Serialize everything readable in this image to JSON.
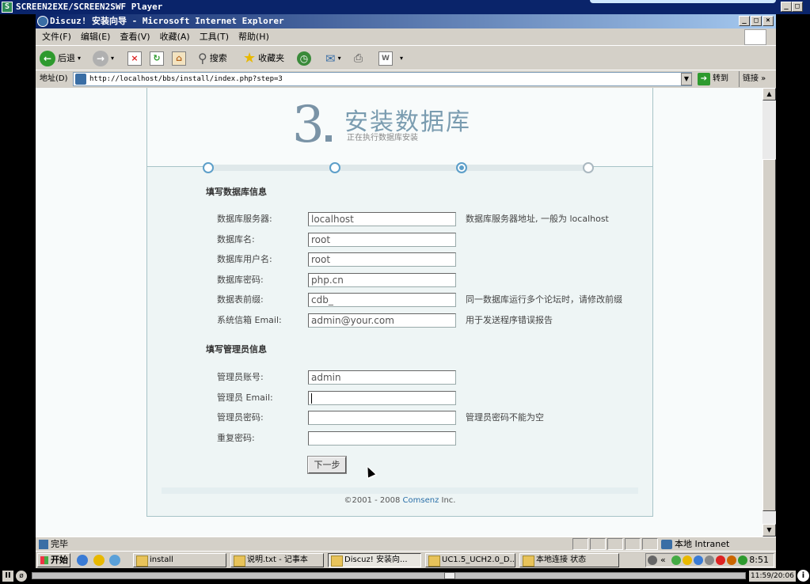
{
  "player": {
    "title": "SCREEN2EXE/SCREEN2SWF Player",
    "time": "11:59/20:06",
    "progress": 0.586
  },
  "browser": {
    "title": "Discuz! 安装向导 - Microsoft Internet Explorer",
    "menu": [
      "文件(F)",
      "编辑(E)",
      "查看(V)",
      "收藏(A)",
      "工具(T)",
      "帮助(H)"
    ],
    "toolbar": {
      "back": "后退",
      "search": "搜索",
      "favorites": "收藏夹"
    },
    "address_label": "地址(D)",
    "url": "http://localhost/bbs/install/index.php?step=3",
    "go": "转到",
    "links": "链接",
    "status": "完毕",
    "zone": "本地 Intranet"
  },
  "page": {
    "step_number": "3",
    "step_title": "安装数据库",
    "step_subtitle": "正在执行数据库安装",
    "steps_total": 4,
    "steps_current": 3,
    "db_section": "填写数据库信息",
    "db_fields": [
      {
        "label": "数据库服务器:",
        "value": "localhost",
        "tip": "数据库服务器地址, 一般为 localhost"
      },
      {
        "label": "数据库名:",
        "value": "root",
        "tip": ""
      },
      {
        "label": "数据库用户名:",
        "value": "root",
        "tip": ""
      },
      {
        "label": "数据库密码:",
        "value": "php.cn",
        "tip": ""
      },
      {
        "label": "数据表前缀:",
        "value": "cdb_",
        "tip": "同一数据库运行多个论坛时，请修改前缀"
      },
      {
        "label": "系统信箱 Email:",
        "value": "admin@your.com",
        "tip": "用于发送程序错误报告"
      }
    ],
    "admin_section": "填写管理员信息",
    "admin_fields": [
      {
        "label": "管理员账号:",
        "value": "admin",
        "tip": ""
      },
      {
        "label": "管理员 Email:",
        "value": "",
        "tip": ""
      },
      {
        "label": "管理员密码:",
        "value": "",
        "tip": "管理员密码不能为空"
      },
      {
        "label": "重复密码:",
        "value": "",
        "tip": ""
      }
    ],
    "next_button": "下一步",
    "footer_prefix": "©2001 - 2008 ",
    "footer_brand": "Comsenz",
    "footer_suffix": " Inc."
  },
  "taskbar": {
    "start": "开始",
    "tasks": [
      "install",
      "说明.txt - 记事本",
      "Discuz! 安装向...",
      "UC1.5_UCH2.0_D...",
      "本地连接 状态"
    ],
    "active_task": 2,
    "clock": "8:51"
  }
}
